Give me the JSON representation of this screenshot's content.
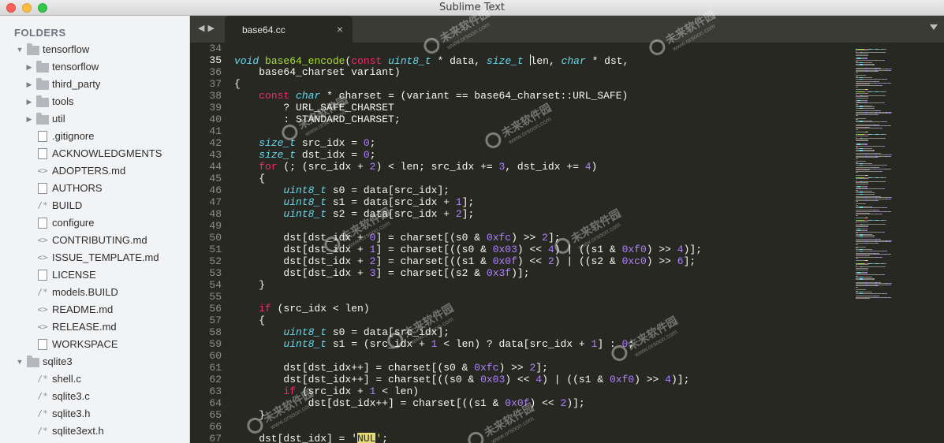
{
  "window": {
    "title": "Sublime Text"
  },
  "sidebar": {
    "header": "FOLDERS",
    "items": [
      {
        "label": "tensorflow",
        "kind": "folder",
        "open": true,
        "depth": 0,
        "icon": "folder-icon"
      },
      {
        "label": "tensorflow",
        "kind": "folder",
        "open": false,
        "depth": 1,
        "icon": "folder-icon"
      },
      {
        "label": "third_party",
        "kind": "folder",
        "open": false,
        "depth": 1,
        "icon": "folder-icon"
      },
      {
        "label": "tools",
        "kind": "folder",
        "open": false,
        "depth": 1,
        "icon": "folder-icon"
      },
      {
        "label": "util",
        "kind": "folder",
        "open": false,
        "depth": 1,
        "icon": "folder-icon"
      },
      {
        "label": ".gitignore",
        "kind": "file",
        "depth": 1,
        "icon": "file-icon"
      },
      {
        "label": "ACKNOWLEDGMENTS",
        "kind": "file",
        "depth": 1,
        "icon": "file-icon"
      },
      {
        "label": "ADOPTERS.md",
        "kind": "markup",
        "depth": 1,
        "icon": "markup-icon"
      },
      {
        "label": "AUTHORS",
        "kind": "file",
        "depth": 1,
        "icon": "file-icon"
      },
      {
        "label": "BUILD",
        "kind": "comment",
        "depth": 1,
        "icon": "comment-icon"
      },
      {
        "label": "configure",
        "kind": "file",
        "depth": 1,
        "icon": "file-icon"
      },
      {
        "label": "CONTRIBUTING.md",
        "kind": "markup",
        "depth": 1,
        "icon": "markup-icon"
      },
      {
        "label": "ISSUE_TEMPLATE.md",
        "kind": "markup",
        "depth": 1,
        "icon": "markup-icon"
      },
      {
        "label": "LICENSE",
        "kind": "file",
        "depth": 1,
        "icon": "file-icon"
      },
      {
        "label": "models.BUILD",
        "kind": "comment",
        "depth": 1,
        "icon": "comment-icon"
      },
      {
        "label": "README.md",
        "kind": "markup",
        "depth": 1,
        "icon": "markup-icon"
      },
      {
        "label": "RELEASE.md",
        "kind": "markup",
        "depth": 1,
        "icon": "markup-icon"
      },
      {
        "label": "WORKSPACE",
        "kind": "file",
        "depth": 1,
        "icon": "file-icon"
      },
      {
        "label": "sqlite3",
        "kind": "folder",
        "open": true,
        "depth": 0,
        "icon": "folder-icon"
      },
      {
        "label": "shell.c",
        "kind": "comment",
        "depth": 1,
        "icon": "comment-icon"
      },
      {
        "label": "sqlite3.c",
        "kind": "comment",
        "depth": 1,
        "icon": "comment-icon"
      },
      {
        "label": "sqlite3.h",
        "kind": "comment",
        "depth": 1,
        "icon": "comment-icon"
      },
      {
        "label": "sqlite3ext.h",
        "kind": "comment",
        "depth": 1,
        "icon": "comment-icon"
      }
    ]
  },
  "tabs": {
    "nav_back": "◀",
    "nav_forward": "▶",
    "items": [
      {
        "label": "base64.cc",
        "active": true,
        "close": "×"
      }
    ],
    "menu_icon": "tab-menu-chevron-icon"
  },
  "editor": {
    "active_line": 35,
    "cursor_line": 35,
    "lines": [
      {
        "n": "34",
        "tokens": []
      },
      {
        "n": "35",
        "tokens": [
          {
            "t": "void",
            "c": "ty"
          },
          {
            "t": " "
          },
          {
            "t": "base64_encode",
            "c": "fn"
          },
          {
            "t": "("
          },
          {
            "t": "const",
            "c": "kw"
          },
          {
            "t": " "
          },
          {
            "t": "uint8_t",
            "c": "ty"
          },
          {
            "t": " * data, "
          },
          {
            "t": "size_t",
            "c": "ty"
          },
          {
            "t": " ",
            "cursor": true
          },
          {
            "t": "len, "
          },
          {
            "t": "char",
            "c": "ty"
          },
          {
            "t": " * dst,"
          }
        ]
      },
      {
        "n": "36",
        "tokens": [
          {
            "t": "    base64_charset variant)"
          }
        ]
      },
      {
        "n": "37",
        "tokens": [
          {
            "t": "{"
          }
        ]
      },
      {
        "n": "38",
        "tokens": [
          {
            "t": "    "
          },
          {
            "t": "const",
            "c": "kw"
          },
          {
            "t": " "
          },
          {
            "t": "char",
            "c": "ty"
          },
          {
            "t": " * charset = (variant == base64_charset::URL_SAFE)"
          }
        ]
      },
      {
        "n": "39",
        "tokens": [
          {
            "t": "        ? URL_SAFE_CHARSET"
          }
        ]
      },
      {
        "n": "40",
        "tokens": [
          {
            "t": "        : STANDARD_CHARSET;"
          }
        ]
      },
      {
        "n": "41",
        "tokens": []
      },
      {
        "n": "42",
        "tokens": [
          {
            "t": "    "
          },
          {
            "t": "size_t",
            "c": "ty"
          },
          {
            "t": " src_idx = "
          },
          {
            "t": "0",
            "c": "nm"
          },
          {
            "t": ";"
          }
        ]
      },
      {
        "n": "43",
        "tokens": [
          {
            "t": "    "
          },
          {
            "t": "size_t",
            "c": "ty"
          },
          {
            "t": " dst_idx = "
          },
          {
            "t": "0",
            "c": "nm"
          },
          {
            "t": ";"
          }
        ]
      },
      {
        "n": "44",
        "tokens": [
          {
            "t": "    "
          },
          {
            "t": "for",
            "c": "kw"
          },
          {
            "t": " (; (src_idx + "
          },
          {
            "t": "2",
            "c": "nm"
          },
          {
            "t": ") < len; src_idx += "
          },
          {
            "t": "3",
            "c": "nm"
          },
          {
            "t": ", dst_idx += "
          },
          {
            "t": "4",
            "c": "nm"
          },
          {
            "t": ")"
          }
        ]
      },
      {
        "n": "45",
        "tokens": [
          {
            "t": "    {"
          }
        ]
      },
      {
        "n": "46",
        "tokens": [
          {
            "t": "        "
          },
          {
            "t": "uint8_t",
            "c": "ty"
          },
          {
            "t": " s0 = data[src_idx];"
          }
        ]
      },
      {
        "n": "47",
        "tokens": [
          {
            "t": "        "
          },
          {
            "t": "uint8_t",
            "c": "ty"
          },
          {
            "t": " s1 = data[src_idx + "
          },
          {
            "t": "1",
            "c": "nm"
          },
          {
            "t": "];"
          }
        ]
      },
      {
        "n": "48",
        "tokens": [
          {
            "t": "        "
          },
          {
            "t": "uint8_t",
            "c": "ty"
          },
          {
            "t": " s2 = data[src_idx + "
          },
          {
            "t": "2",
            "c": "nm"
          },
          {
            "t": "];"
          }
        ]
      },
      {
        "n": "49",
        "tokens": []
      },
      {
        "n": "50",
        "tokens": [
          {
            "t": "        dst[dst_idx + "
          },
          {
            "t": "0",
            "c": "nm"
          },
          {
            "t": "] = charset[(s0 & "
          },
          {
            "t": "0xfc",
            "c": "nm"
          },
          {
            "t": ") >> "
          },
          {
            "t": "2",
            "c": "nm"
          },
          {
            "t": "];"
          }
        ]
      },
      {
        "n": "51",
        "tokens": [
          {
            "t": "        dst[dst_idx + "
          },
          {
            "t": "1",
            "c": "nm"
          },
          {
            "t": "] = charset[((s0 & "
          },
          {
            "t": "0x03",
            "c": "nm"
          },
          {
            "t": ") << "
          },
          {
            "t": "4",
            "c": "nm"
          },
          {
            "t": ") | ((s1 & "
          },
          {
            "t": "0xf0",
            "c": "nm"
          },
          {
            "t": ") >> "
          },
          {
            "t": "4",
            "c": "nm"
          },
          {
            "t": ")];"
          }
        ]
      },
      {
        "n": "52",
        "tokens": [
          {
            "t": "        dst[dst_idx + "
          },
          {
            "t": "2",
            "c": "nm"
          },
          {
            "t": "] = charset[((s1 & "
          },
          {
            "t": "0x0f",
            "c": "nm"
          },
          {
            "t": ") << "
          },
          {
            "t": "2",
            "c": "nm"
          },
          {
            "t": ") | ((s2 & "
          },
          {
            "t": "0xc0",
            "c": "nm"
          },
          {
            "t": ") >> "
          },
          {
            "t": "6",
            "c": "nm"
          },
          {
            "t": "];"
          }
        ]
      },
      {
        "n": "53",
        "tokens": [
          {
            "t": "        dst[dst_idx + "
          },
          {
            "t": "3",
            "c": "nm"
          },
          {
            "t": "] = charset[(s2 & "
          },
          {
            "t": "0x3f",
            "c": "nm"
          },
          {
            "t": ")];"
          }
        ]
      },
      {
        "n": "54",
        "tokens": [
          {
            "t": "    }"
          }
        ]
      },
      {
        "n": "55",
        "tokens": []
      },
      {
        "n": "56",
        "tokens": [
          {
            "t": "    "
          },
          {
            "t": "if",
            "c": "kw"
          },
          {
            "t": " (src_idx < len)"
          }
        ]
      },
      {
        "n": "57",
        "tokens": [
          {
            "t": "    {"
          }
        ]
      },
      {
        "n": "58",
        "tokens": [
          {
            "t": "        "
          },
          {
            "t": "uint8_t",
            "c": "ty"
          },
          {
            "t": " s0 = data[src_idx];"
          }
        ]
      },
      {
        "n": "59",
        "tokens": [
          {
            "t": "        "
          },
          {
            "t": "uint8_t",
            "c": "ty"
          },
          {
            "t": " s1 = (src_idx + "
          },
          {
            "t": "1",
            "c": "nm"
          },
          {
            "t": " < len) ? data[src_idx + "
          },
          {
            "t": "1",
            "c": "nm"
          },
          {
            "t": "] : "
          },
          {
            "t": "0",
            "c": "nm"
          },
          {
            "t": ";"
          }
        ]
      },
      {
        "n": "60",
        "tokens": []
      },
      {
        "n": "61",
        "tokens": [
          {
            "t": "        dst[dst_idx++] = charset[(s0 & "
          },
          {
            "t": "0xfc",
            "c": "nm"
          },
          {
            "t": ") >> "
          },
          {
            "t": "2",
            "c": "nm"
          },
          {
            "t": "];"
          }
        ]
      },
      {
        "n": "62",
        "tokens": [
          {
            "t": "        dst[dst_idx++] = charset[((s0 & "
          },
          {
            "t": "0x03",
            "c": "nm"
          },
          {
            "t": ") << "
          },
          {
            "t": "4",
            "c": "nm"
          },
          {
            "t": ") | ((s1 & "
          },
          {
            "t": "0xf0",
            "c": "nm"
          },
          {
            "t": ") >> "
          },
          {
            "t": "4",
            "c": "nm"
          },
          {
            "t": ")];"
          }
        ]
      },
      {
        "n": "63",
        "tokens": [
          {
            "t": "        "
          },
          {
            "t": "if",
            "c": "kw"
          },
          {
            "t": " (src_idx + "
          },
          {
            "t": "1",
            "c": "nm"
          },
          {
            "t": " < len)"
          }
        ]
      },
      {
        "n": "64",
        "tokens": [
          {
            "t": "            dst[dst_idx++] = charset[((s1 & "
          },
          {
            "t": "0x0f",
            "c": "nm"
          },
          {
            "t": ") << "
          },
          {
            "t": "2",
            "c": "nm"
          },
          {
            "t": ")];"
          }
        ]
      },
      {
        "n": "65",
        "tokens": [
          {
            "t": "    }"
          }
        ]
      },
      {
        "n": "66",
        "tokens": []
      },
      {
        "n": "67",
        "tokens": [
          {
            "t": "    dst[dst_idx] = "
          },
          {
            "t": "'"
          },
          {
            "t": "NUL",
            "c": "hl"
          },
          {
            "t": "'",
            "c": "st"
          },
          {
            "t": ";"
          }
        ]
      }
    ]
  },
  "watermark": {
    "brand": "未来软件园",
    "url": "www.orsoon.com"
  },
  "colors": {
    "editor_bg": "#272822",
    "keyword": "#f92672",
    "type": "#66d9ef",
    "function": "#a6e22e",
    "number": "#ae81ff",
    "string": "#e6db74"
  }
}
